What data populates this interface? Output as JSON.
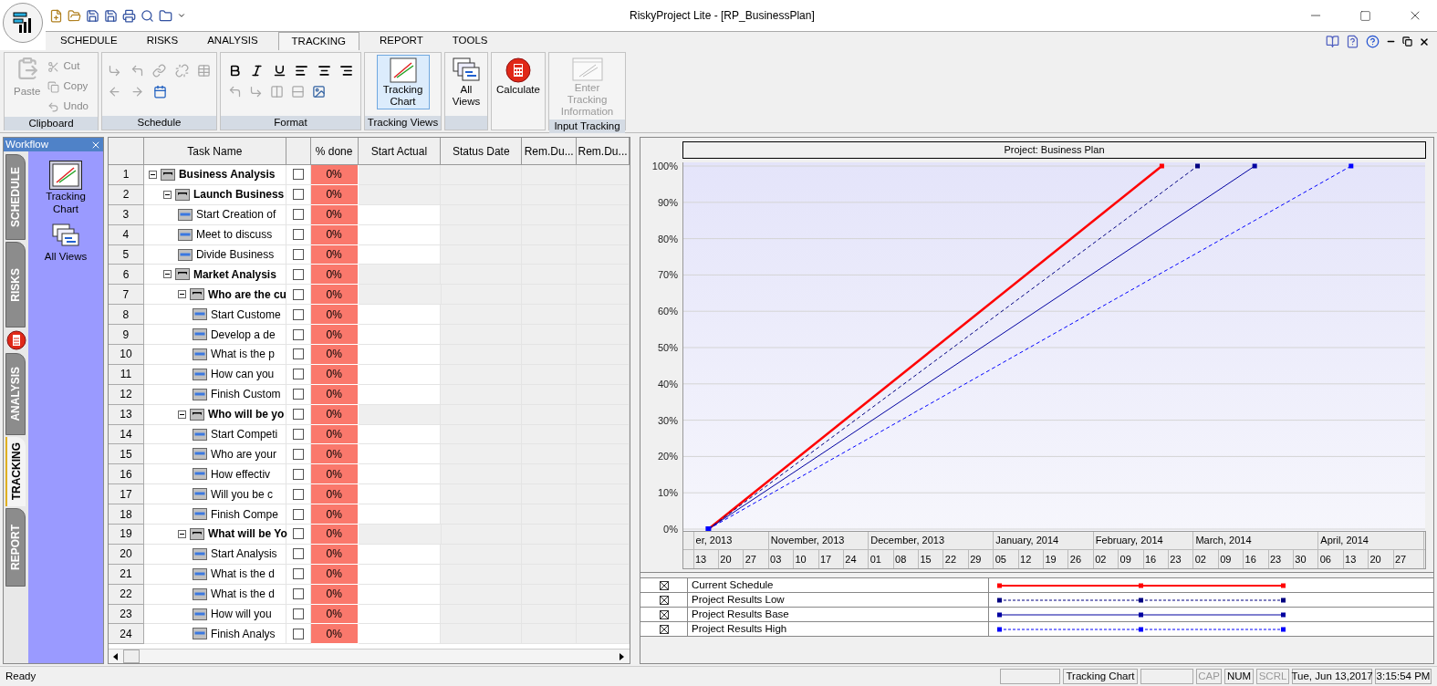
{
  "window": {
    "title": "RiskyProject Lite - [RP_BusinessPlan]"
  },
  "ribbon_tabs": [
    {
      "label": "SCHEDULE",
      "selected": false
    },
    {
      "label": "RISKS",
      "selected": false
    },
    {
      "label": "ANALYSIS",
      "selected": false
    },
    {
      "label": "TRACKING",
      "selected": true
    },
    {
      "label": "REPORT",
      "selected": false
    },
    {
      "label": "TOOLS",
      "selected": false
    }
  ],
  "ribbon_groups": [
    {
      "kind": "clipboard",
      "label": "Clipboard",
      "buttons": [
        {
          "label": "Paste",
          "disabled": true
        },
        {
          "label": "Cut",
          "disabled": true
        },
        {
          "label": "Copy",
          "disabled": true
        },
        {
          "label": "Undo",
          "disabled": true
        }
      ]
    },
    {
      "kind": "schedule",
      "label": "Schedule"
    },
    {
      "kind": "format",
      "label": "Format"
    },
    {
      "kind": "large",
      "label": "Tracking Views",
      "buttons": [
        {
          "label": "Tracking Chart",
          "selected": true,
          "disabled": false
        }
      ]
    },
    {
      "kind": "large",
      "label_bar": true,
      "buttons": [
        {
          "label": "All Views",
          "selected": false,
          "disabled": false
        }
      ]
    },
    {
      "kind": "large",
      "label_bar": false,
      "buttons": [
        {
          "label": "Calculate",
          "selected": false,
          "disabled": false
        }
      ]
    },
    {
      "kind": "large",
      "label": "Input Tracking",
      "buttons": [
        {
          "label": "Enter Tracking Information",
          "selected": false,
          "disabled": true
        }
      ]
    }
  ],
  "workflow": {
    "title": "Workflow",
    "tabs": [
      {
        "kind": "tab",
        "label": "SCHEDULE",
        "selected": false
      },
      {
        "kind": "tab",
        "label": "RISKS",
        "selected": false
      },
      {
        "kind": "calculator"
      },
      {
        "kind": "tab",
        "label": "ANALYSIS",
        "selected": false
      },
      {
        "kind": "tab",
        "label": "TRACKING",
        "selected": true
      },
      {
        "kind": "tab",
        "label": "REPORT",
        "selected": false
      }
    ],
    "items": [
      {
        "label": "Tracking Chart",
        "selected": true
      },
      {
        "label": "All Views",
        "selected": false
      }
    ]
  },
  "table": {
    "columns": [
      "Task Name",
      "% done",
      "Start Actual",
      "Status Date",
      "Rem.Du...",
      "Rem.Du..."
    ],
    "rows": [
      {
        "number": "1",
        "name": "Business Analysis",
        "kind": "summary",
        "expanded": true,
        "checked": false,
        "done": "0%",
        "children": [
          {
            "number": "2",
            "name": "Launch Business",
            "kind": "summary",
            "expanded": true,
            "checked": false,
            "done": "0%",
            "children": [
              {
                "number": "3",
                "name": "Start Creation of",
                "kind": "task",
                "checked": false,
                "done": "0%"
              },
              {
                "number": "4",
                "name": "Meet to discuss",
                "kind": "task",
                "checked": false,
                "done": "0%"
              },
              {
                "number": "5",
                "name": "Divide Business",
                "kind": "task",
                "checked": false,
                "done": "0%"
              }
            ]
          },
          {
            "number": "6",
            "name": "Market Analysis",
            "kind": "summary",
            "expanded": true,
            "checked": false,
            "done": "0%",
            "children": [
              {
                "number": "7",
                "name": "Who are the cu",
                "kind": "summary",
                "expanded": true,
                "checked": false,
                "done": "0%",
                "children": [
                  {
                    "number": "8",
                    "name": "Start Custome",
                    "kind": "task",
                    "checked": false,
                    "done": "0%"
                  },
                  {
                    "number": "9",
                    "name": "Develop a de",
                    "kind": "task",
                    "checked": false,
                    "done": "0%"
                  },
                  {
                    "number": "10",
                    "name": "What is the p",
                    "kind": "task",
                    "checked": false,
                    "done": "0%"
                  },
                  {
                    "number": "11",
                    "name": "How can you",
                    "kind": "task",
                    "checked": false,
                    "done": "0%"
                  },
                  {
                    "number": "12",
                    "name": "Finish Custom",
                    "kind": "task",
                    "checked": false,
                    "done": "0%"
                  }
                ]
              },
              {
                "number": "13",
                "name": "Who will be yo",
                "kind": "summary",
                "expanded": true,
                "checked": false,
                "done": "0%",
                "children": [
                  {
                    "number": "14",
                    "name": "Start Competi",
                    "kind": "task",
                    "checked": false,
                    "done": "0%"
                  },
                  {
                    "number": "15",
                    "name": "Who are your",
                    "kind": "task",
                    "checked": false,
                    "done": "0%"
                  },
                  {
                    "number": "16",
                    "name": "How effectiv",
                    "kind": "task",
                    "checked": false,
                    "done": "0%"
                  },
                  {
                    "number": "17",
                    "name": "Will you be c",
                    "kind": "task",
                    "checked": false,
                    "done": "0%"
                  },
                  {
                    "number": "18",
                    "name": "Finish Compe",
                    "kind": "task",
                    "checked": false,
                    "done": "0%"
                  }
                ]
              },
              {
                "number": "19",
                "name": "What will be Yo",
                "kind": "summary",
                "expanded": true,
                "checked": false,
                "done": "0%",
                "children": [
                  {
                    "number": "20",
                    "name": "Start Analysis",
                    "kind": "task",
                    "checked": false,
                    "done": "0%"
                  },
                  {
                    "number": "21",
                    "name": "What is the d",
                    "kind": "task",
                    "checked": false,
                    "done": "0%"
                  },
                  {
                    "number": "22",
                    "name": "What is the d",
                    "kind": "task",
                    "checked": false,
                    "done": "0%"
                  },
                  {
                    "number": "23",
                    "name": "How will you",
                    "kind": "task",
                    "checked": false,
                    "done": "0%"
                  },
                  {
                    "number": "24",
                    "name": "Finish Analys",
                    "kind": "task",
                    "checked": false,
                    "done": "0%"
                  }
                ]
              }
            ]
          }
        ]
      }
    ]
  },
  "chart": {
    "chart_data": {
      "type": "line",
      "title": "Project: Business Plan",
      "x": [
        "2013-10-15",
        "2014-02-19",
        "2014-03-01",
        "2014-03-17",
        "2014-04-13"
      ],
      "xlim": [
        "2013-10-08",
        "2014-05-04"
      ],
      "ylim": [
        0,
        100
      ],
      "grid": true,
      "yticks": [
        {
          "value": 0,
          "label": "0%"
        },
        {
          "value": 10,
          "label": "10%"
        },
        {
          "value": 20,
          "label": "20%"
        },
        {
          "value": 30,
          "label": "30%"
        },
        {
          "value": 40,
          "label": "40%"
        },
        {
          "value": 50,
          "label": "50%"
        },
        {
          "value": 60,
          "label": "60%"
        },
        {
          "value": 70,
          "label": "70%"
        },
        {
          "value": 80,
          "label": "80%"
        },
        {
          "value": 90,
          "label": "90%"
        },
        {
          "value": 100,
          "label": "100%"
        }
      ],
      "series": [
        {
          "name": "Current Schedule",
          "color": "#ff0000",
          "line_style": "solid",
          "values": [
            0,
            100,
            null,
            null,
            null
          ]
        },
        {
          "name": "Project Results Low",
          "color": "#000080",
          "line_style": "dashed",
          "values": [
            0,
            92.7,
            100,
            null,
            null
          ]
        },
        {
          "name": "Project Results Base",
          "color": "#0000a0",
          "line_style": "solid",
          "values": [
            0,
            83,
            89.5,
            100,
            null
          ]
        },
        {
          "name": "Project Results High",
          "color": "#0000ff",
          "line_style": "dashed",
          "values": [
            0,
            70.6,
            76.1,
            85,
            100
          ]
        }
      ],
      "xticks": [
        {
          "value": "2013-10-13",
          "label": "13"
        },
        {
          "value": "2013-10-20",
          "label": "20"
        },
        {
          "value": "2013-10-27",
          "label": "27"
        },
        {
          "value": "2013-11-03",
          "label": "03"
        },
        {
          "value": "2013-11-10",
          "label": "10"
        },
        {
          "value": "2013-11-17",
          "label": "17"
        },
        {
          "value": "2013-11-24",
          "label": "24"
        },
        {
          "value": "2013-12-01",
          "label": "01"
        },
        {
          "value": "2013-12-08",
          "label": "08"
        },
        {
          "value": "2013-12-15",
          "label": "15"
        },
        {
          "value": "2013-12-22",
          "label": "22"
        },
        {
          "value": "2013-12-29",
          "label": "29"
        },
        {
          "value": "2014-01-05",
          "label": "05"
        },
        {
          "value": "2014-01-12",
          "label": "12"
        },
        {
          "value": "2014-01-19",
          "label": "19"
        },
        {
          "value": "2014-01-26",
          "label": "26"
        },
        {
          "value": "2014-02-02",
          "label": "02"
        },
        {
          "value": "2014-02-09",
          "label": "09"
        },
        {
          "value": "2014-02-16",
          "label": "16"
        },
        {
          "value": "2014-02-23",
          "label": "23"
        },
        {
          "value": "2014-03-02",
          "label": "02"
        },
        {
          "value": "2014-03-09",
          "label": "09"
        },
        {
          "value": "2014-03-16",
          "label": "16"
        },
        {
          "value": "2014-03-23",
          "label": "23"
        },
        {
          "value": "2014-03-30",
          "label": "30"
        },
        {
          "value": "2014-04-06",
          "label": "06"
        },
        {
          "value": "2014-04-13",
          "label": "13"
        },
        {
          "value": "2014-04-20",
          "label": "20"
        },
        {
          "value": "2014-04-27",
          "label": "27"
        }
      ]
    },
    "months": [
      "er, 2013",
      "November, 2013",
      "December, 2013",
      "January, 2014",
      "February, 2014",
      "March, 2014",
      "April, 2014"
    ]
  },
  "status_bar": {
    "message": "Ready",
    "panes": [
      {
        "kind": "blank"
      },
      {
        "kind": "text",
        "text": "Tracking Chart"
      },
      {
        "kind": "blank"
      },
      {
        "kind": "indicator",
        "text": "CAP",
        "on": false
      },
      {
        "kind": "indicator",
        "text": "NUM",
        "on": true
      },
      {
        "kind": "indicator",
        "text": "SCRL",
        "on": false
      },
      {
        "kind": "text",
        "text": "Tue, Jun 13,2017"
      },
      {
        "kind": "text",
        "text": "3:15:54 PM"
      }
    ]
  }
}
